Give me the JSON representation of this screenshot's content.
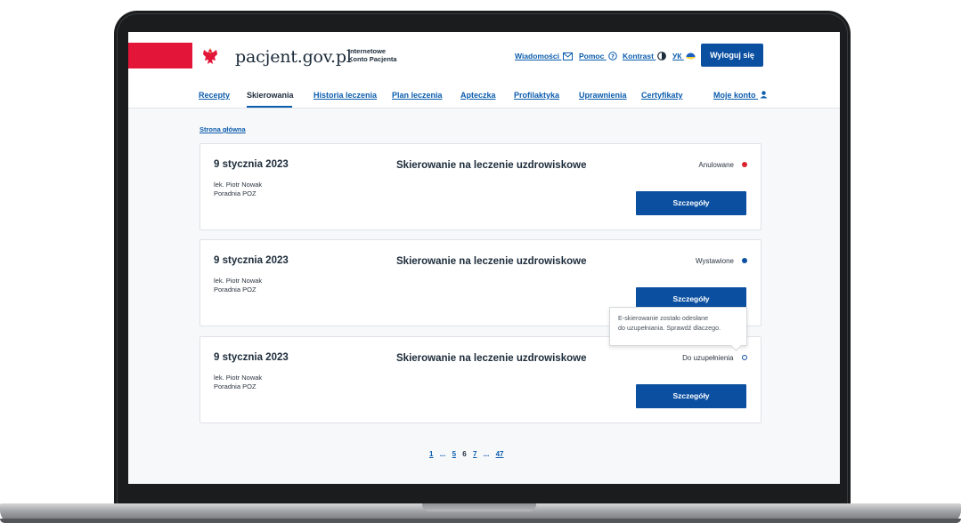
{
  "header": {
    "site_name": "pacjent.gov.pl",
    "site_sub": "Internetowe\nKonto Pacjenta",
    "links": {
      "messages": "Wiadomości",
      "help": "Pomoc",
      "contrast": "Kontrast",
      "lang": "УК"
    },
    "logout": "Wyloguj się"
  },
  "nav": {
    "recepty": "Recepty",
    "skierowania": "Skierowania",
    "historia": "Historia leczenia",
    "plan": "Plan leczenia",
    "apteczka": "Apteczka",
    "profilaktyka": "Profilaktyka",
    "uprawnienia": "Uprawnienia",
    "certyfikaty": "Certyfikaty",
    "konto": "Moje konto"
  },
  "breadcrumb": "Strona główna",
  "cards": [
    {
      "date": "9 stycznia 2023",
      "doctor": "lek. Piotr Nowak",
      "clinic": "Poradnia POZ",
      "title": "Skierowanie na leczenie uzdrowiskowe",
      "status": "Anulowane",
      "button": "Szczegóły",
      "status_color": "#d9242f"
    },
    {
      "date": "9 stycznia 2023",
      "doctor": "lek. Piotr Nowak",
      "clinic": "Poradnia POZ",
      "title": "Skierowanie na leczenie uzdrowiskowe",
      "status": "Wystawione",
      "button": "Szczegóły",
      "status_color": "#0a4fa0"
    },
    {
      "date": "9 stycznia 2023",
      "doctor": "lek. Piotr Nowak",
      "clinic": "Poradnia POZ",
      "title": "Skierowanie na leczenie uzdrowiskowe",
      "status": "Do uzupełnienia",
      "button": "Szczegóły",
      "status_color": "#0a4fa0"
    }
  ],
  "tooltip": {
    "line1": "E-skierowanie zostało odesłane",
    "line2": "do uzupełniania. Sprawdź dlaczego."
  },
  "pagination": {
    "p1": "1",
    "ellipsis1": "...",
    "p5": "5",
    "current": "6",
    "p7": "7",
    "ellipsis2": "...",
    "p47": "47"
  },
  "colors": {
    "accent": "#0a4fa0",
    "flag_red": "#e3163a"
  }
}
